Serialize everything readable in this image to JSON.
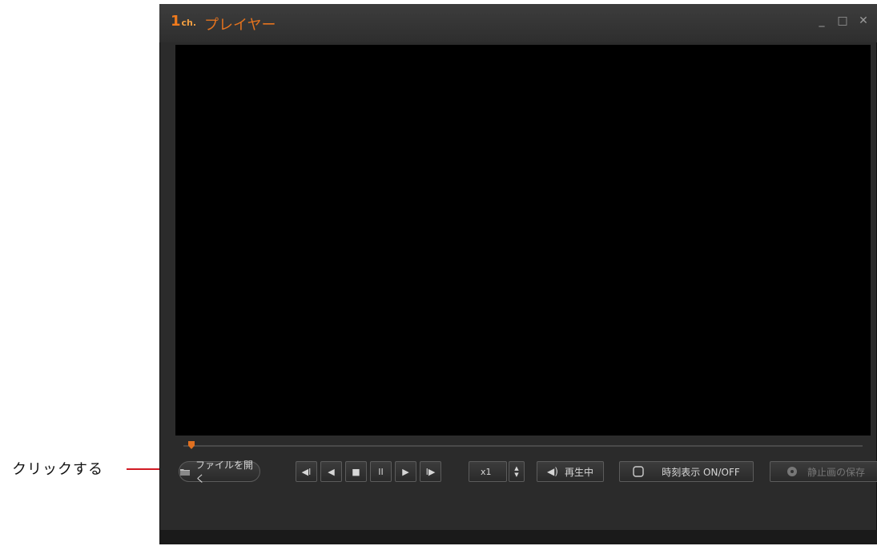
{
  "annotation": {
    "label": "クリックする"
  },
  "window": {
    "title": "プレイヤー",
    "logo": {
      "main": "1",
      "sub": "ch."
    },
    "controls": {
      "minimize": "_",
      "maximize": "□",
      "close": "✕"
    }
  },
  "seekbar": {
    "progress": 0.01
  },
  "toolbar": {
    "open_file": "ファイルを開く",
    "transport": {
      "step_back": "◀I",
      "rewind": "◀",
      "stop": "■",
      "pause": "II",
      "play": "▶",
      "step_forward": "I▶"
    },
    "speed": "x1",
    "speed_arrows": {
      "up": "▲",
      "down": "▼"
    },
    "volume_icon": "◀)",
    "playing": "再生中",
    "time_display": "時刻表示 ON/OFF",
    "save_still": "静止画の保存"
  },
  "colors": {
    "accent": "#e4731e",
    "annotation": "#d11a24",
    "window_bg": "#2b2b2b",
    "video_bg": "#000000"
  }
}
